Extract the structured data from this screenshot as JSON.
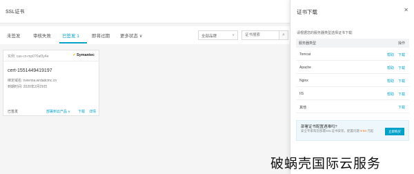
{
  "header": {
    "title": "SSL证书"
  },
  "tabs": [
    {
      "label": "未签发"
    },
    {
      "label": "审核失败"
    },
    {
      "label": "已签发 1"
    },
    {
      "label": "即将过期"
    },
    {
      "label": "更多状态 ∨"
    }
  ],
  "filter": {
    "selected": "全部品牌",
    "chevron": "∨"
  },
  "search": {
    "placeholder": "证书搜索",
    "button_icon": "⌕"
  },
  "card": {
    "instance": "实例: cas-cn-mp0?0af3y4e",
    "brand": "Symantec",
    "brand_mark": "✔",
    "cert_id": "cert-1551449419197",
    "domain": "绑定域名: nvienna.wrdadcmc.cn",
    "expiry": "到期时间: 2020年2月29日",
    "status": "已签发",
    "deploy": "部署到云产品 ∨",
    "download": "下载",
    "detail": "详情"
  },
  "panel": {
    "title": "证书下载",
    "close": "✕",
    "intro": "请根据您的服务器类型选择证书下载:",
    "col_server": "服务器类型",
    "col_action": "操作",
    "rows": [
      {
        "server": "Tomcat",
        "help": "帮助",
        "download": "下载"
      },
      {
        "server": "Apache",
        "help": "帮助",
        "download": "下载"
      },
      {
        "server": "Nginx",
        "help": "帮助",
        "download": "下载"
      },
      {
        "server": "IIS",
        "help": "帮助",
        "download": "下载"
      },
      {
        "server": "其他",
        "help": "",
        "download": "下载"
      }
    ]
  },
  "promo": {
    "question": "部署证书配置遇难吗?",
    "text": "安全专家帮您部署SSL证书安装，配置问题",
    "price": "¥ 84",
    "text2": "元起",
    "button": "立即购买"
  },
  "watermark": "破蜗壳国际云服务"
}
